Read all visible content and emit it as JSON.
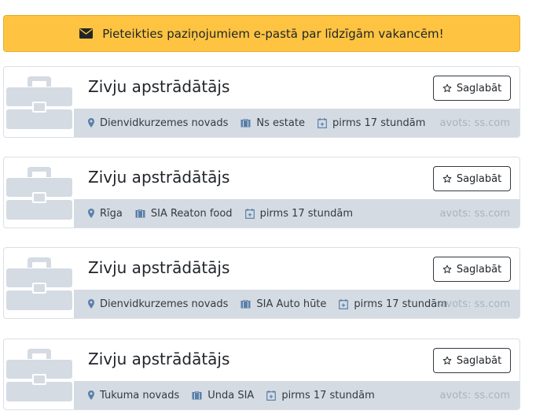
{
  "alert": {
    "text": "Pieteikties paziņojumiem e-pastā par līdzīgām vakancēm!",
    "icon": "envelope-icon"
  },
  "colors": {
    "alert_bg": "#fec441",
    "meta_bg": "#d4dbe3",
    "logo_placeholder": "#d4dbe3"
  },
  "jobs": [
    {
      "title": "Zivju apstrādātājs",
      "save_label": "Saglabāt",
      "location": "Dienvidkurzemes novads",
      "company": "Ns estate",
      "posted": "pirms 17 stundām",
      "source": "avots: ss.com"
    },
    {
      "title": "Zivju apstrādātājs",
      "save_label": "Saglabāt",
      "location": "Rīga",
      "company": "SIA Reaton food",
      "posted": "pirms 17 stundām",
      "source": "avots: ss.com"
    },
    {
      "title": "Zivju apstrādātājs",
      "save_label": "Saglabāt",
      "location": "Dienvidkurzemes novads",
      "company": "SIA Auto hūte",
      "posted": "pirms 17 stundām",
      "source": "avots: ss.com"
    },
    {
      "title": "Zivju apstrādātājs",
      "save_label": "Saglabāt",
      "location": "Tukuma novads",
      "company": "Unda SIA",
      "posted": "pirms 17 stundām",
      "source": "avots: ss.com"
    }
  ]
}
